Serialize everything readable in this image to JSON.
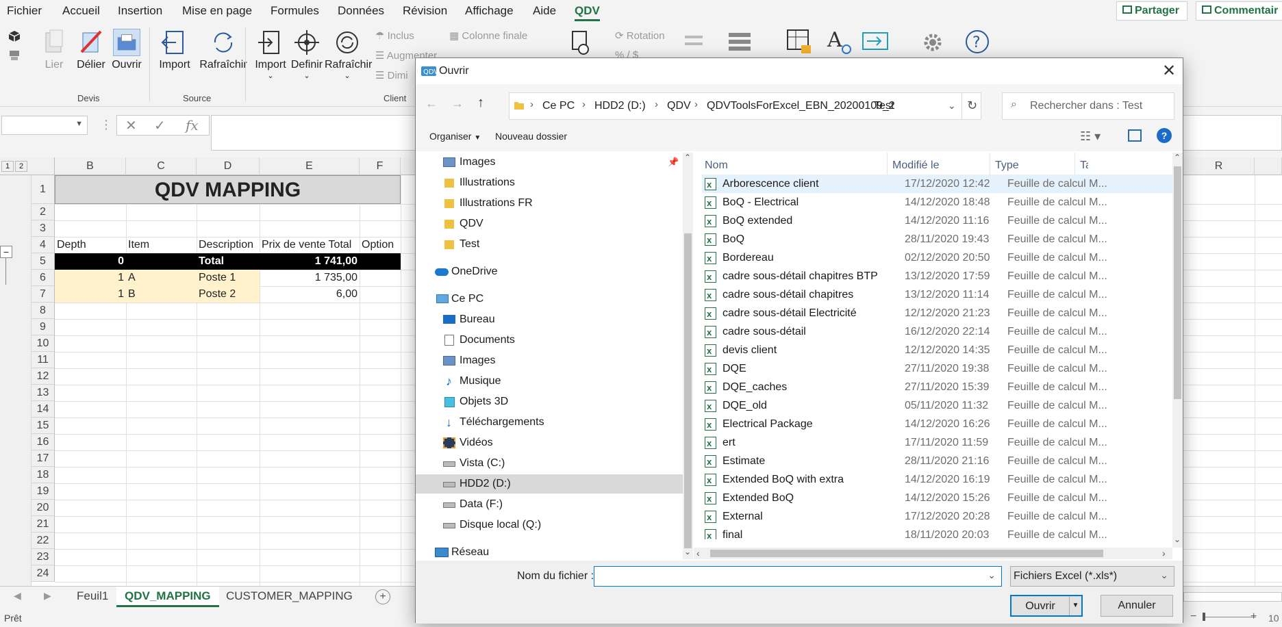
{
  "menu": {
    "items": [
      "Fichier",
      "Accueil",
      "Insertion",
      "Mise en page",
      "Formules",
      "Données",
      "Révision",
      "Affichage",
      "Aide",
      "QDV"
    ],
    "active": "QDV",
    "share_label": "Partager",
    "comments_label": "Commentair"
  },
  "ribbon": {
    "devis": {
      "lier": "Lier",
      "delier": "Délier",
      "ouvrir": "Ouvrir",
      "group": "Devis"
    },
    "source": {
      "import": "Import",
      "rafraichir": "Rafraîchir",
      "group": "Source"
    },
    "client": {
      "import": "Import",
      "definir": "Definir",
      "rafraichir": "Rafraîchir",
      "inclus": "Inclus",
      "augmenter": "Augmenter",
      "dimi": "Dimi",
      "colonne_finale": "Colonne finale",
      "group": "Client"
    },
    "other": {
      "rotation": "Rotation",
      "percent": "% / $"
    }
  },
  "formula_bar": {
    "cancel": "✕",
    "confirm": "✓",
    "fx": "fx"
  },
  "sheet": {
    "outline_levels": [
      "1",
      "2"
    ],
    "columns": [
      "B",
      "C",
      "D",
      "E",
      "F",
      "R"
    ],
    "rows": [
      "1",
      "2",
      "3",
      "4",
      "5",
      "6",
      "7",
      "8",
      "9",
      "10",
      "11",
      "12",
      "13",
      "14",
      "15",
      "16",
      "17",
      "18",
      "19",
      "20",
      "21",
      "22",
      "23",
      "24"
    ],
    "title": "QDV MAPPING",
    "headers": {
      "depth": "Depth",
      "item": "Item",
      "description": "Description",
      "price": "Prix de vente Total",
      "option": "Option"
    },
    "data_rows": [
      {
        "depth": "0",
        "item": "",
        "description": "Total",
        "price": "1 741,00"
      },
      {
        "depth": "1",
        "item": "A",
        "description": "Poste 1",
        "price": "1 735,00"
      },
      {
        "depth": "1",
        "item": "B",
        "description": "Poste 2",
        "price": "6,00"
      }
    ],
    "collapse_btn": "−"
  },
  "tabs": [
    "Feuil1",
    "QDV_MAPPING",
    "CUSTOMER_MAPPING"
  ],
  "active_tab": "QDV_MAPPING",
  "status": {
    "ready": "Prêt",
    "zoom_minus": "−",
    "zoom_plus": "+",
    "zoom": "10"
  },
  "dialog": {
    "title": "Ouvrir",
    "breadcrumbs": [
      "Ce PC",
      "HDD2 (D:)",
      "QDV",
      "QDVToolsForExcel_EBN_20200109_2",
      "Test"
    ],
    "search_placeholder": "Rechercher dans : Test",
    "organize": "Organiser",
    "new_folder": "Nouveau dossier",
    "help": "?",
    "nav_items": [
      {
        "label": "Images",
        "icon": "image-icon"
      },
      {
        "label": "Illustrations",
        "icon": "folder-icon"
      },
      {
        "label": "Illustrations FR",
        "icon": "folder-icon"
      },
      {
        "label": "QDV",
        "icon": "folder-icon"
      },
      {
        "label": "Test",
        "icon": "folder-icon"
      },
      {
        "label": "OneDrive",
        "icon": "cloud-icon"
      },
      {
        "label": "Ce PC",
        "icon": "computer-icon"
      },
      {
        "label": "Bureau",
        "icon": "desktop-icon"
      },
      {
        "label": "Documents",
        "icon": "documents-icon"
      },
      {
        "label": "Images",
        "icon": "image-icon"
      },
      {
        "label": "Musique",
        "icon": "music-icon"
      },
      {
        "label": "Objets 3D",
        "icon": "cube-icon"
      },
      {
        "label": "Téléchargements",
        "icon": "download-icon"
      },
      {
        "label": "Vidéos",
        "icon": "video-icon"
      },
      {
        "label": "Vista (C:)",
        "icon": "drive-icon"
      },
      {
        "label": "HDD2 (D:)",
        "icon": "drive-icon"
      },
      {
        "label": "Data (F:)",
        "icon": "drive-icon"
      },
      {
        "label": "Disque local (Q:)",
        "icon": "drive-icon"
      },
      {
        "label": "Réseau",
        "icon": "network-icon"
      }
    ],
    "selected_nav": "HDD2 (D:)",
    "columns": {
      "name": "Nom",
      "modified": "Modifié le",
      "type": "Type",
      "extra": "Ta"
    },
    "files": [
      {
        "name": "Arborescence client",
        "date": "17/12/2020 12:42",
        "type": "Feuille de calcul M..."
      },
      {
        "name": "BoQ - Electrical",
        "date": "14/12/2020 18:48",
        "type": "Feuille de calcul M..."
      },
      {
        "name": "BoQ extended",
        "date": "14/12/2020 11:16",
        "type": "Feuille de calcul M..."
      },
      {
        "name": "BoQ",
        "date": "28/11/2020 19:43",
        "type": "Feuille de calcul M..."
      },
      {
        "name": "Bordereau",
        "date": "02/12/2020 20:50",
        "type": "Feuille de calcul M..."
      },
      {
        "name": "cadre sous-détail chapitres BTP",
        "date": "13/12/2020 17:59",
        "type": "Feuille de calcul M..."
      },
      {
        "name": "cadre sous-détail chapitres",
        "date": "13/12/2020 11:14",
        "type": "Feuille de calcul M..."
      },
      {
        "name": "cadre sous-détail Electricité",
        "date": "12/12/2020 21:23",
        "type": "Feuille de calcul M..."
      },
      {
        "name": "cadre sous-détail",
        "date": "16/12/2020 22:14",
        "type": "Feuille de calcul M..."
      },
      {
        "name": "devis client",
        "date": "12/12/2020 14:35",
        "type": "Feuille de calcul M..."
      },
      {
        "name": "DQE",
        "date": "27/11/2020 19:38",
        "type": "Feuille de calcul M..."
      },
      {
        "name": "DQE_caches",
        "date": "27/11/2020 15:39",
        "type": "Feuille de calcul M..."
      },
      {
        "name": "DQE_old",
        "date": "05/11/2020 11:32",
        "type": "Feuille de calcul M..."
      },
      {
        "name": "Electrical Package",
        "date": "14/12/2020 16:26",
        "type": "Feuille de calcul M..."
      },
      {
        "name": "ert",
        "date": "17/11/2020 11:59",
        "type": "Feuille de calcul M..."
      },
      {
        "name": "Estimate",
        "date": "28/11/2020 21:16",
        "type": "Feuille de calcul M..."
      },
      {
        "name": "Extended BoQ with extra",
        "date": "14/12/2020 16:19",
        "type": "Feuille de calcul M..."
      },
      {
        "name": "Extended BoQ",
        "date": "14/12/2020 15:26",
        "type": "Feuille de calcul M..."
      },
      {
        "name": "External",
        "date": "17/12/2020 20:28",
        "type": "Feuille de calcul M..."
      },
      {
        "name": "final",
        "date": "18/11/2020 20:03",
        "type": "Feuille de calcul M..."
      }
    ],
    "filename_label": "Nom du fichier :",
    "filename_value": "",
    "filetype": "Fichiers Excel (*.xls*)",
    "open_btn": "Ouvrir",
    "cancel_btn": "Annuler"
  },
  "colors": {
    "excel_green": "#217346",
    "accent_blue": "#0078d7",
    "header_black": "#000000",
    "row_highlight": "#fff2cc"
  }
}
